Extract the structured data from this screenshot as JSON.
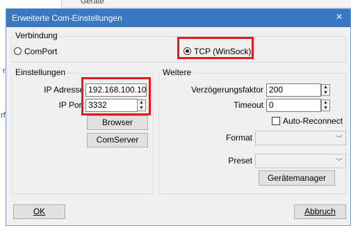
{
  "background": {
    "top_label": "Geräte",
    "side_letters": [
      "n",
      "rf"
    ]
  },
  "dialog": {
    "title": "Erweiterte Com-Einstellungen",
    "close_symbol": "×"
  },
  "verbindung": {
    "title": "Verbindung",
    "options": [
      {
        "label": "ComPort",
        "selected": false
      },
      {
        "label": "TCP (WinSock)",
        "selected": true
      }
    ]
  },
  "einstellungen": {
    "title": "Einstellungen",
    "ip_address_label": "IP Adresse",
    "ip_address_value": "192.168.100.10",
    "ip_port_label": "IP Port",
    "ip_port_value": "3332",
    "browser_button": "Browser",
    "comserver_button": "ComServer"
  },
  "weitere": {
    "title": "Weitere",
    "delay_label": "Verzögerungsfaktor",
    "delay_value": "200",
    "timeout_label": "Timeout",
    "timeout_value": "0",
    "auto_reconnect_label": "Auto-Reconnect",
    "auto_reconnect_checked": false,
    "format_label": "Format",
    "format_value": "",
    "preset_label": "Preset",
    "preset_value": "",
    "device_manager_button": "Gerätemanager"
  },
  "footer": {
    "ok_button": "OK",
    "cancel_button": "Abbruch"
  },
  "colors": {
    "titlebar": "#3b78c4",
    "highlight": "#e11b22"
  }
}
